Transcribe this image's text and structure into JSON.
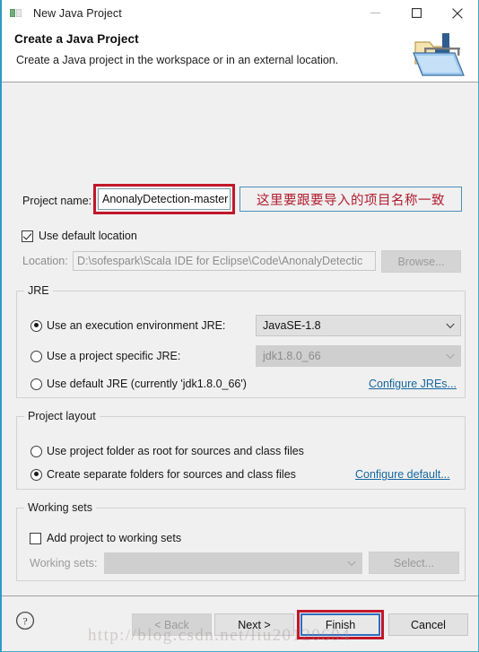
{
  "window": {
    "title": "New Java Project",
    "title_icon": "java-project-icon",
    "controls": {
      "minimize": "minimize-icon",
      "maximize": "maximize-icon",
      "close": "close-icon"
    }
  },
  "header": {
    "title": "Create a Java Project",
    "description": "Create a Java project in the workspace or in an external location.",
    "icon": "new-java-project-wizard-icon"
  },
  "project": {
    "name_label": "Project name:",
    "name_value": "AnonalyDetection-master",
    "annotation": "这里要跟要导入的项目名称一致",
    "use_default_location_label": "Use default location",
    "use_default_location_checked": true,
    "location_label": "Location:",
    "location_value": "D:\\sofespark\\Scala IDE for Eclipse\\Code\\AnonalyDetectic",
    "browse_label": "Browse..."
  },
  "jre": {
    "group_title": "JRE",
    "option_env_label": "Use an execution environment JRE:",
    "option_env_selected": true,
    "env_value": "JavaSE-1.8",
    "option_specific_label": "Use a project specific JRE:",
    "option_specific_selected": false,
    "specific_value": "jdk1.8.0_66",
    "option_default_label": "Use default JRE (currently 'jdk1.8.0_66')",
    "option_default_selected": false,
    "configure_link": "Configure JREs..."
  },
  "layout": {
    "group_title": "Project layout",
    "option_root_label": "Use project folder as root for sources and class files",
    "option_root_selected": false,
    "option_separate_label": "Create separate folders for sources and class files",
    "option_separate_selected": true,
    "configure_link": "Configure default..."
  },
  "working_sets": {
    "group_title": "Working sets",
    "add_label": "Add project to working sets",
    "add_checked": false,
    "sets_label": "Working sets:",
    "sets_value": "",
    "select_label": "Select..."
  },
  "footer": {
    "help_icon": "help-question-icon",
    "back_label": "< Back",
    "back_enabled": false,
    "next_label": "Next >",
    "next_enabled": true,
    "finish_label": "Finish",
    "finish_focused": true,
    "cancel_label": "Cancel"
  },
  "watermark": "http://blog.csdn.net/liu20120604",
  "colors": {
    "window_border": "#2e9bc9",
    "annotation_red": "#c0172a",
    "link_blue": "#1767a0",
    "focus_blue": "#2e6ec0",
    "dialog_bg": "#f0f0f0"
  }
}
